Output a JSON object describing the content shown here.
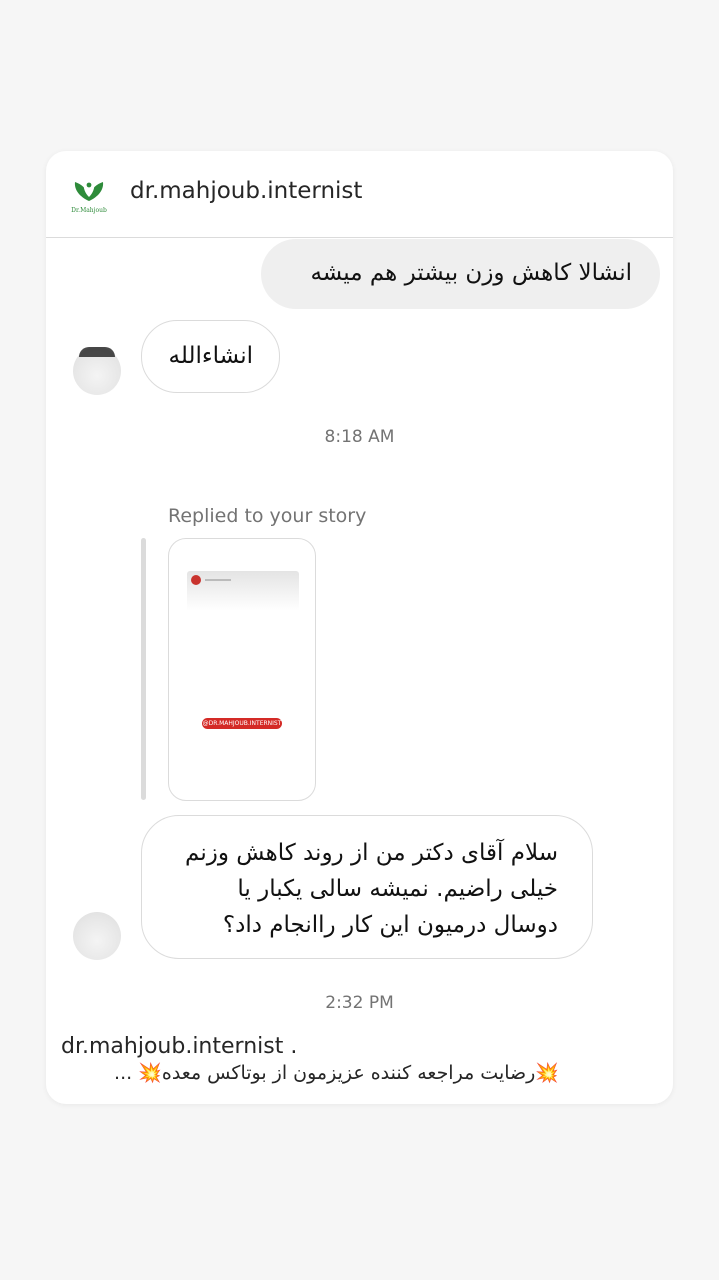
{
  "header": {
    "username": "dr.mahjoub.internist",
    "logo_text": "Dr.Mahjoub",
    "logo_color": "#2e8b3a"
  },
  "messages": {
    "outgoing_1": "انشالا کاهش وزن بیشتر هم میشه",
    "incoming_1": "انشاءالله",
    "timestamp_1": "8:18 AM",
    "replied_label": "Replied to your story",
    "story_tag": "@DR.MAHJOUB.INTERNIST",
    "incoming_2_lines": [
      "سلام آقای دکتر من از روند کاهش وزنم",
      "خیلی راضیم. نمیشه سالی یکبار یا",
      "دوسال درمیون این کار راانجام داد؟"
    ],
    "timestamp_2": "2:32 PM"
  },
  "preview": {
    "username": "dr.mahjoub.internist .",
    "text": "💥رضایت مراجعه کننده عزیزمون از بوتاکس معده💥 ..."
  },
  "colors": {
    "story_tag_red": "#d42a26",
    "outgoing_bubble": "#efefef"
  }
}
